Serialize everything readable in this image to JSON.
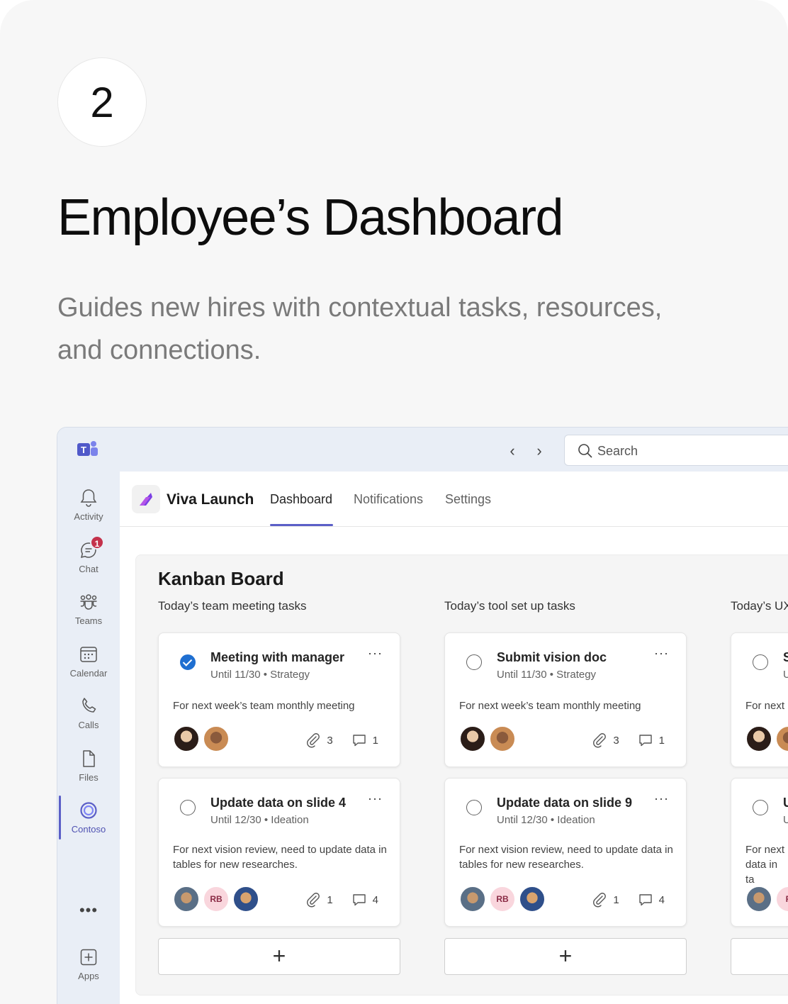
{
  "step_number": "2",
  "heading": "Employee’s Dashboard",
  "subheading": "Guides new hires with contextual tasks, resources, and connections.",
  "app": {
    "search_placeholder": "Search",
    "rail": [
      {
        "label": "Activity",
        "icon": "bell-icon"
      },
      {
        "label": "Chat",
        "icon": "chat-icon",
        "badge": "1"
      },
      {
        "label": "Teams",
        "icon": "teams-icon"
      },
      {
        "label": "Calendar",
        "icon": "calendar-icon"
      },
      {
        "label": "Calls",
        "icon": "phone-icon"
      },
      {
        "label": "Files",
        "icon": "file-icon"
      },
      {
        "label": "Contoso",
        "icon": "contoso-icon",
        "active": true
      },
      {
        "label": "Apps",
        "icon": "add-app-icon"
      }
    ],
    "more_label": "•••",
    "viva_name": "Viva Launch",
    "tabs": [
      "Dashboard",
      "Notifications",
      "Settings"
    ],
    "active_tab": "Dashboard"
  },
  "board": {
    "title": "Kanban Board",
    "columns": [
      {
        "title": "Today’s team meeting tasks",
        "cards": [
          {
            "title": "Meeting with manager",
            "meta": "Until 11/30 • Strategy",
            "desc": "For next week’s team monthly meeting",
            "done": true,
            "attachments": "3",
            "comments": "1",
            "people": [
              "photo",
              "photo"
            ]
          },
          {
            "title": "Update data on slide 4",
            "meta": "Until 12/30 • Ideation",
            "desc": "For next vision review, need to update data in tables for new researches.",
            "done": false,
            "attachments": "1",
            "comments": "4",
            "people": [
              "photo",
              "RB",
              "photo"
            ]
          }
        ]
      },
      {
        "title": "Today’s tool set up tasks",
        "cards": [
          {
            "title": "Submit vision doc",
            "meta": "Until 11/30 • Strategy",
            "desc": "For next week’s team monthly meeting",
            "done": false,
            "attachments": "3",
            "comments": "1",
            "people": [
              "photo",
              "photo"
            ]
          },
          {
            "title": "Update data on slide 9",
            "meta": "Until 12/30 • Ideation",
            "desc": "For next vision review, need to update data in tables for new researches.",
            "done": false,
            "attachments": "1",
            "comments": "4",
            "people": [
              "photo",
              "RB",
              "photo"
            ]
          }
        ]
      },
      {
        "title": "Today’s UX",
        "cards": [
          {
            "title": "S",
            "meta": "U",
            "desc": "For next",
            "done": false
          },
          {
            "title": "U",
            "meta": "U",
            "desc": "For next data in ta",
            "done": false
          }
        ]
      }
    ],
    "add_label": "+"
  },
  "colors": {
    "accent": "#5b5fc7",
    "check_blue": "#1f6fd1",
    "badge_red": "#c4314b"
  }
}
